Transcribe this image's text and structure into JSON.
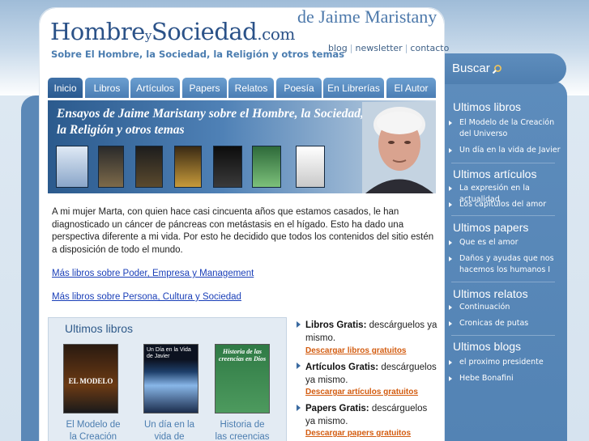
{
  "header": {
    "brand_main_1": "Hombre",
    "brand_small": "y",
    "brand_main_2": "Sociedad",
    "brand_tld": ".com",
    "byline": "de Jaime Maristany",
    "tagline": "Sobre El Hombre, la Sociedad, la Religión y otros temas",
    "links": {
      "blog": "blog",
      "newsletter": "newsletter",
      "contacto": "contacto"
    }
  },
  "nav": {
    "tabs": [
      "Inicio",
      "Libros",
      "Artículos",
      "Papers",
      "Relatos",
      "Poesía",
      "En Librerías",
      "El Autor"
    ],
    "active": "Inicio"
  },
  "banner": {
    "title": "Ensayos de Jaime Maristany sobre el Hombre, la Sociedad, la Religión y otros temas"
  },
  "intro": {
    "text": "A mi mujer Marta, con quien hace casi cincuenta años que estamos casados, le han diagnosticado un cáncer de páncreas con metástasis en el hígado. Esto ha dado una perspectiva diferente a mi vida. Por esto he decidido que todos los contenidos del sitio estén a disposición de todo el mundo.",
    "link1": "Más libros sobre Poder, Empresa y Management",
    "link2": "Más libros sobre Persona, Cultura y Sociedad"
  },
  "books_box": {
    "title": "Ultimos libros",
    "books": [
      {
        "caption_1": "El Modelo de",
        "caption_2": "la Creación",
        "cover_text": "EL MODELO"
      },
      {
        "caption_1": "Un día en la",
        "caption_2": "vida de",
        "cover_text": "Un Día en la Vida de Javier"
      },
      {
        "caption_1": "Historia de",
        "caption_2": "las creencias",
        "cover_text": "Historia de las creencias en Dios"
      }
    ]
  },
  "downloads": [
    {
      "label": "Libros Gratis:",
      "text": "descárguelos ya mismo.",
      "link": "Descargar libros gratuitos"
    },
    {
      "label": "Artículos Gratis:",
      "text": "descárguelos ya mismo.",
      "link": "Descargar artículos gratuitos"
    },
    {
      "label": "Papers Gratis:",
      "text": "descárguelos ya mismo.",
      "link": "Descargar papers gratuitos"
    }
  ],
  "sidebar": {
    "search_label": "Buscar",
    "sections": [
      {
        "title": "Ultimos libros",
        "items": [
          "El Modelo de la Creación del Universo",
          "Un día en la vida de Javier"
        ]
      },
      {
        "title": "Ultimos artículos",
        "items": [
          "La expresión en la actualidad",
          "Los capítulos del amor"
        ]
      },
      {
        "title": "Ultimos papers",
        "items": [
          "Que es el amor",
          "Daños y ayudas que nos hacemos los humanos I"
        ]
      },
      {
        "title": "Ultimos relatos",
        "items": [
          "Continuación",
          "Cronicas de putas"
        ]
      },
      {
        "title": "Ultimos blogs",
        "items": [
          "el proximo presidente",
          "Hebe Bonafini"
        ]
      }
    ]
  },
  "colors": {
    "brand_blue": "#2b5288",
    "sidebar_blue": "#5b88b7",
    "link_blue": "#1a3fb8",
    "download_orange": "#d35c10"
  }
}
